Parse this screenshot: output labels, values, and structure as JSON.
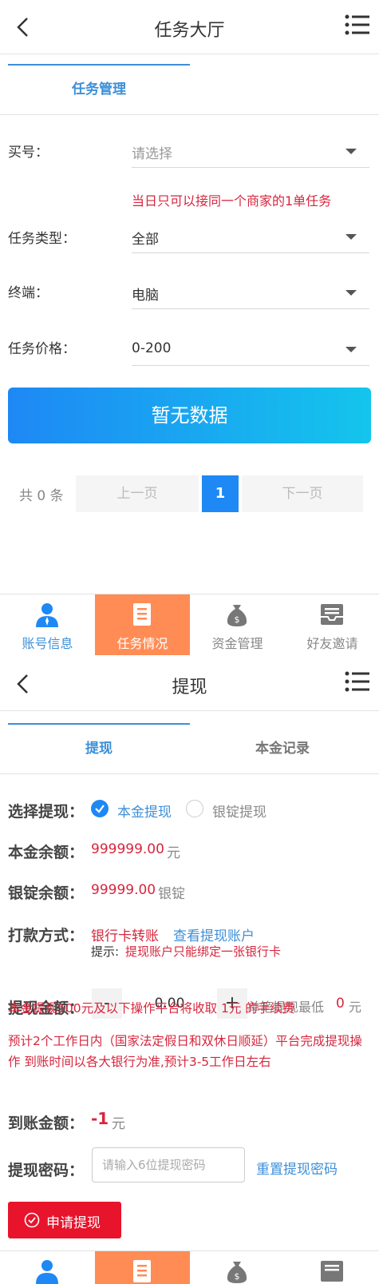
{
  "screen1": {
    "header": {
      "title": "任务大厅"
    },
    "tabs": [
      {
        "label": "任务管理"
      }
    ],
    "form": {
      "account_label": "买号：",
      "account_placeholder": "请选择",
      "warning": "当日只可以接同一个商家的1单任务",
      "task_type_label": "任务类型：",
      "task_type_value": "全部",
      "terminal_label": "终端：",
      "terminal_value": "电脑",
      "price_label": "任务价格：",
      "price_value": "0-200"
    },
    "no_data": "暂无数据",
    "pager": {
      "total": "共 0 条",
      "prev": "上一页",
      "page": "1",
      "next": "下一页"
    }
  },
  "bottom_nav": [
    {
      "label": "账号信息",
      "icon": "user-icon"
    },
    {
      "label": "任务情况",
      "icon": "clipboard-icon"
    },
    {
      "label": "资金管理",
      "icon": "money-bag-icon"
    },
    {
      "label": "好友邀请",
      "icon": "inbox-icon"
    }
  ],
  "screen2": {
    "header": {
      "title": "提现"
    },
    "tabs": [
      {
        "label": "提现"
      },
      {
        "label": "本金记录"
      }
    ],
    "select_label": "选择提现：",
    "option_principal": "本金提现",
    "option_ingot": "银锭提现",
    "principal_balance_label": "本金余额：",
    "principal_balance_value": "999999.00",
    "principal_balance_unit": "元",
    "ingot_balance_label": "银锭余额：",
    "ingot_balance_value": "99999.00",
    "ingot_balance_unit": "银锭",
    "payment_label": "打款方式：",
    "payment_method": "银行卡转账",
    "view_account": "查看提现账户",
    "tip_prefix": "提示:",
    "tip_text": "提现账户只能绑定一张银行卡",
    "amount_label": "提现金额：",
    "amount_minus": "-",
    "amount_value": "0.00",
    "amount_plus": "+",
    "min_text": "单笔提现最低",
    "min_value": "0",
    "min_unit": "元",
    "fee_notice": "本金提现500元及以下操作平台将收取 1元 的手续费",
    "time_notice": "预计2个工作日内（国家法定假日和双休日顺延）平台完成提现操作 到账时间以各大银行为准,预计3-5工作日左右",
    "received_label": "到账金额：",
    "received_value": "-1",
    "received_unit": "元",
    "password_label": "提现密码：",
    "password_placeholder": "请输入6位提现密码",
    "reset_password": "重置提现密码",
    "apply_button": "申请提现"
  },
  "colors": {
    "accent": "#1e88f5",
    "active_nav": "#ff8c55",
    "warning": "#d7263d",
    "apply": "#e8142c"
  }
}
